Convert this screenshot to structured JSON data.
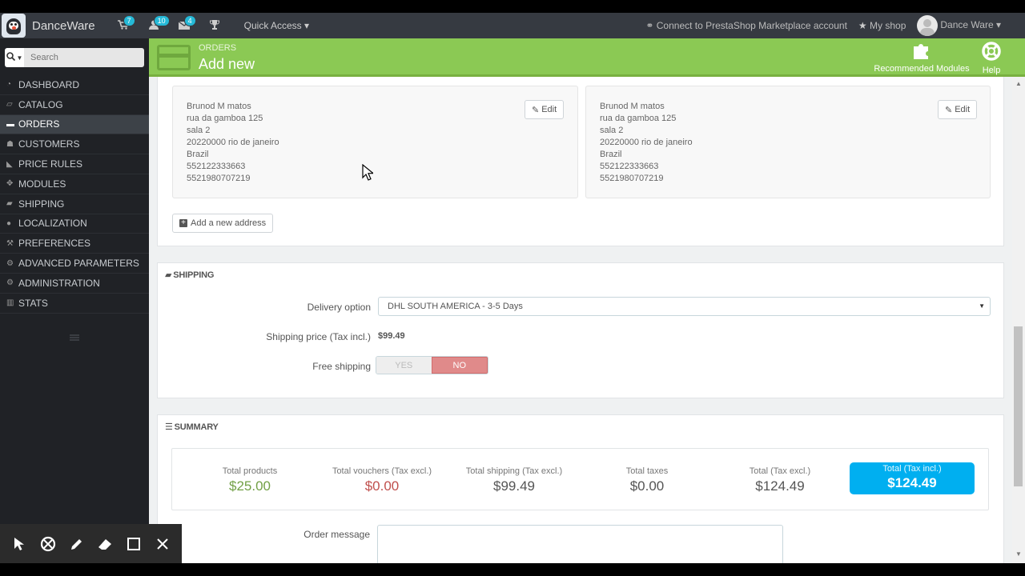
{
  "header": {
    "shop_name": "DanceWare",
    "notifications": [
      {
        "icon": "cart-icon",
        "count": "7"
      },
      {
        "icon": "user-icon",
        "count": "10"
      },
      {
        "icon": "mail-icon",
        "count": "4"
      },
      {
        "icon": "trophy-icon",
        "count": ""
      }
    ],
    "quick_access": "Quick Access",
    "connect_label": "Connect to PrestaShop Marketplace account",
    "my_shop": "My shop",
    "user_name": "Dance Ware"
  },
  "sidebar": {
    "search_placeholder": "Search",
    "items": [
      {
        "label": "DASHBOARD",
        "icon": "dashboard-icon"
      },
      {
        "label": "CATALOG",
        "icon": "book-icon"
      },
      {
        "label": "ORDERS",
        "icon": "credit-card-icon"
      },
      {
        "label": "CUSTOMERS",
        "icon": "users-icon"
      },
      {
        "label": "PRICE RULES",
        "icon": "tag-icon"
      },
      {
        "label": "MODULES",
        "icon": "puzzle-icon"
      },
      {
        "label": "SHIPPING",
        "icon": "truck-icon"
      },
      {
        "label": "LOCALIZATION",
        "icon": "globe-icon"
      },
      {
        "label": "PREFERENCES",
        "icon": "wrench-icon"
      },
      {
        "label": "ADVANCED PARAMETERS",
        "icon": "cogs-icon"
      },
      {
        "label": "ADMINISTRATION",
        "icon": "gear-icon"
      },
      {
        "label": "STATS",
        "icon": "bar-chart-icon"
      }
    ]
  },
  "page_head": {
    "breadcrumb": "ORDERS",
    "title": "Add new",
    "recommended_modules": "Recommended Modules",
    "help": "Help"
  },
  "addresses": {
    "delivery": {
      "lines": [
        "Brunod M matos",
        "rua da gamboa 125",
        "sala 2",
        "20220000 rio de janeiro",
        "Brazil",
        "552122333663",
        "5521980707219"
      ],
      "edit_label": "Edit"
    },
    "invoice": {
      "lines": [
        "Brunod M matos",
        "rua da gamboa 125",
        "sala 2",
        "20220000 rio de janeiro",
        "Brazil",
        "552122333663",
        "5521980707219"
      ],
      "edit_label": "Edit"
    },
    "add_label": "Add a new address"
  },
  "shipping": {
    "title": "SHIPPING",
    "delivery_option_label": "Delivery option",
    "delivery_option_value": "DHL SOUTH AMERICA - 3-5 Days",
    "shipping_price_label": "Shipping price (Tax incl.)",
    "shipping_price_value": "$99.49",
    "free_shipping_label": "Free shipping",
    "yes_label": "YES",
    "no_label": "NO"
  },
  "summary": {
    "title": "SUMMARY",
    "total_products_label": "Total products",
    "total_products_value": "$25.00",
    "total_vouchers_label": "Total vouchers (Tax excl.)",
    "total_vouchers_value": "$0.00",
    "total_shipping_label": "Total shipping (Tax excl.)",
    "total_shipping_value": "$99.49",
    "total_taxes_label": "Total taxes",
    "total_taxes_value": "$0.00",
    "total_excl_label": "Total (Tax excl.)",
    "total_excl_value": "$124.49",
    "total_incl_label": "Total (Tax incl.)",
    "total_incl_value": "$124.49"
  },
  "order_message_label": "Order message",
  "colors": {
    "header_bg": "#363a41",
    "sidebar_bg": "#202226",
    "page_head_green": "#8bc954",
    "badge_blue": "#25b9d7",
    "total_blue": "#00aff0",
    "no_red": "#e08a8a"
  }
}
